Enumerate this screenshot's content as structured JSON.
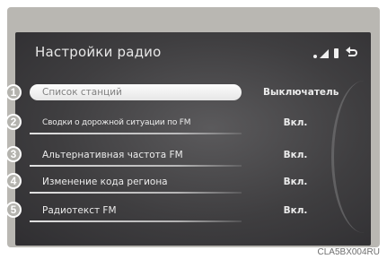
{
  "screen": {
    "title": "Настройки радио",
    "status_icons": [
      "signal-dots-icon",
      "signal-strength-icon",
      "battery-icon",
      "back-icon"
    ]
  },
  "menu": {
    "items": [
      {
        "callout": "1",
        "label": "Список станций",
        "value": "Выключатель"
      },
      {
        "callout": "2",
        "label": "Сводки о дорожной ситуации по FM",
        "value": "Вкл."
      },
      {
        "callout": "3",
        "label": "Альтернативная частота FM",
        "value": "Вкл."
      },
      {
        "callout": "4",
        "label": "Изменение кода региона",
        "value": "Вкл."
      },
      {
        "callout": "5",
        "label": "Радиотекст FM",
        "value": "Вкл."
      }
    ]
  },
  "figure_code": "CLA5BX004RU",
  "colors": {
    "screen_bg": "#3f3e40",
    "bezel": "#b9b7b2",
    "callout": "#b4b3ae",
    "highlight": "#f2f2f2"
  }
}
